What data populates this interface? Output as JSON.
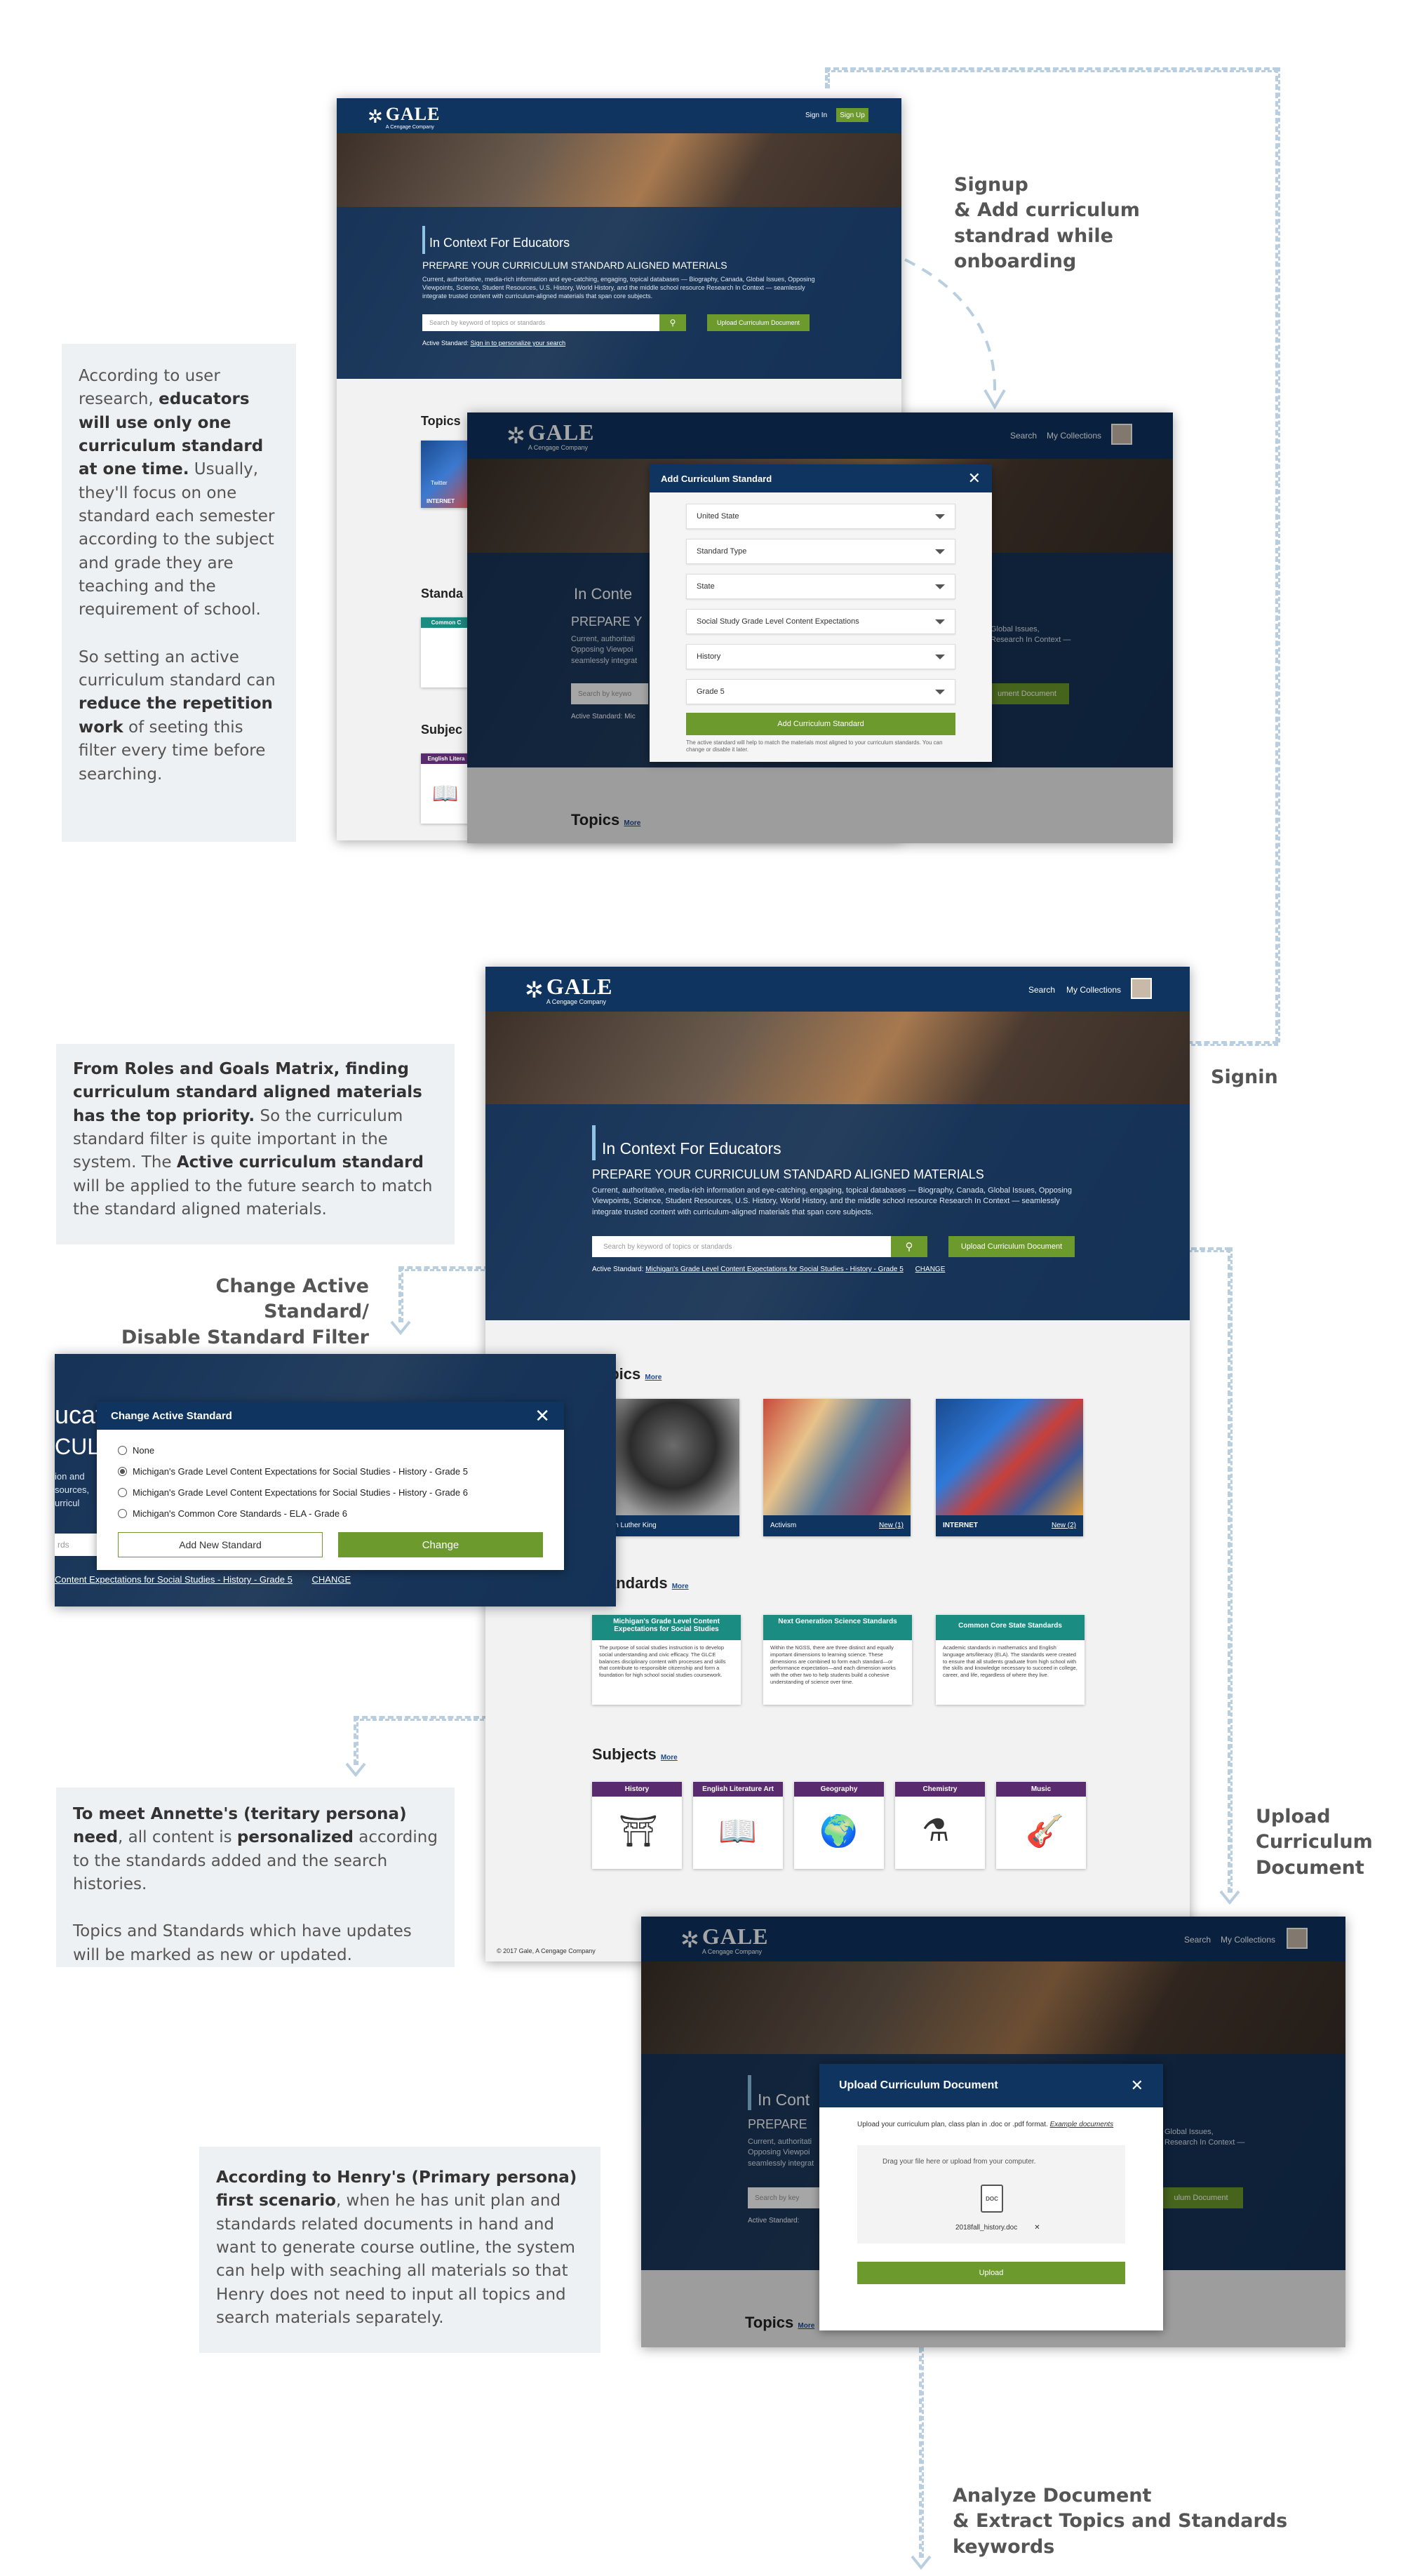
{
  "notes": {
    "educators_single_standard": {
      "p1_a": "According to user research, ",
      "p1_b": "educators will use only one curriculum standard at one time.",
      "p1_c": " Usually, they'll focus on one standard each semester according to the subject and grade they are teaching and the requirement of school.",
      "p2_a": "So setting an active curriculum standard can ",
      "p2_b": "reduce the repetition work",
      "p2_c": " of seeting this filter every time before searching."
    },
    "roles_goals": {
      "a": "From Roles and Goals Matrix, finding curriculum standard aligned materials has the top priority.",
      "b": " So the curriculum standard filter is quite important in the system. The ",
      "c": "Active curriculum standard",
      "d": " will be applied to the future search to match the standard aligned materials."
    },
    "annette": {
      "a": "To meet Annette's (teritary persona) need",
      "b": ", all content is ",
      "c": "personalized",
      "d": " according to the standards added and the search histories.",
      "p2": "Topics and Standards which have updates will be marked as new or updated."
    },
    "henry": {
      "a": "According to Henry's (Primary persona) first scenario",
      "b": ", when he has unit plan and standards related documents in hand and want to generate course outline, the system can help with seaching all materials so that Henry does not need to input all topics and search materials separately."
    }
  },
  "annotations": {
    "signup": [
      "Signup",
      "& Add curriculum",
      "standrad while",
      "onboarding"
    ],
    "signin": "Signin",
    "change_active": [
      "Change Active Standard/",
      "Disable Standard Filter"
    ],
    "upload": [
      "Upload",
      "Curriculum",
      "Document"
    ],
    "analyze": [
      "Analyze Document",
      "& Extract Topics and Standards",
      "keywords"
    ]
  },
  "brand": {
    "name": "GALE",
    "sub": "A Cengage Company"
  },
  "header": {
    "sign_in": "Sign In",
    "sign_up": "Sign Up",
    "search": "Search",
    "collections": "My Collections"
  },
  "hero": {
    "title": "In Context For Educators",
    "subtitle": "PREPARE YOUR CURRICULUM STANDARD ALIGNED MATERIALS",
    "desc": "Current, authoritative, media-rich information and eye-catching, engaging, topical databases — Biography, Canada, Global Issues, Opposing Viewpoints, Science, Student Resources, U.S. History, World History, and the middle school resource Research In Context — seamlessly integrate trusted content with curriculum-aligned materials that span core subjects.",
    "search_placeholder": "Search by keyword of topics or standards",
    "upload_btn": "Upload Curriculum Document",
    "active_label": "Active Standard:",
    "active_signin": "Sign in to personalize your search",
    "active_value": "Michigan's Grade Level Content Expectations for Social Studies - History - Grade 5",
    "change": "CHANGE"
  },
  "add_modal": {
    "title": "Add Curriculum Standard",
    "fields": [
      "United State",
      "Standard Type",
      "State",
      "Social Study Grade Level Content Expectations",
      "History",
      "Grade 5"
    ],
    "button": "Add Curriculum Standard",
    "note": "The active standard will help to match the materials most aligned to your curriculum standards. You can change or disable it later."
  },
  "change_modal": {
    "title": "Change Active Standard",
    "options": [
      "None",
      "Michigan's Grade Level Content Expectations for Social Studies - History - Grade 5",
      "Michigan's Grade Level Content Expectations for Social Studies - History - Grade 6",
      "Michigan's Common Core Standards - ELA - Grade 6"
    ],
    "selected_index": 1,
    "add_btn": "Add New Standard",
    "change_btn": "Change",
    "bg_title": "ucat",
    "bg_line": "CULU",
    "bg_text": [
      "ion and",
      "sources,",
      "urricul"
    ],
    "bg_search": "rds",
    "bg_active": "Content Expectations for Social Studies - History - Grade 5",
    "bg_change": "CHANGE"
  },
  "sections": {
    "topics": "Topics",
    "standards": "Standards",
    "subjects": "Subjects",
    "more": "More"
  },
  "topics": [
    {
      "name": "Martin Luther King",
      "badge": ""
    },
    {
      "name": "Activism",
      "badge": "New (1)"
    },
    {
      "name": "INTERNET",
      "badge": "New (2)"
    }
  ],
  "standards": [
    {
      "title": "Michigan's Grade Level Content Expectations for Social Studies",
      "body": "The purpose of social studies instruction is to develop social understanding and civic efficacy. The GLCE balances disciplinary content with processes and skills that contribute to responsible citizenship and form a foundation for high school social studies coursework."
    },
    {
      "title": "Next Generation Science Standards",
      "body": "Within the NGSS, there are three distinct and equally important dimensions to learning science. These dimensions are combined to form each standard—or performance expectation—and each dimension works with the other two to help students build a cohesive understanding of science over time."
    },
    {
      "title": "Common Core State Standards",
      "body": "Academic standards in mathematics and English language arts/literacy (ELA). The standards were created to ensure that all students graduate from high school with the skills and knowledge necessary to succeed in college, career, and life, regardless of where they live."
    }
  ],
  "subjects": [
    "History",
    "English Literature Art",
    "Geography",
    "Chemistry",
    "Music"
  ],
  "footer": "© 2017 Gale, A Cengage Company",
  "upload_modal": {
    "title": "Upload Curriculum Document",
    "desc": "Upload your curriculum plan, class plan in .doc or .pdf format. ",
    "example": "Example documents",
    "drop": "Drag your file here or upload from your computer.",
    "file": "2018fall_history.doc",
    "file_icon": "DOC",
    "button": "Upload"
  },
  "bg_fragments": {
    "topics_std": "Standa",
    "subj": "Subjec",
    "eng": "English Litera",
    "internet": "INTERNET",
    "common": "Common C",
    "in_context": "In Cont",
    "in_conte": "In Conte",
    "prepare": "PREPARE Y",
    "prepare2": "PRAPARE",
    "prepare3": "PREPARE",
    "current": "Current, authoritati",
    "opposing": "Opposing Viewpoi",
    "seam": "seamlessly integrat",
    "search_by": "Search by keywo",
    "search_by2": "Search by key",
    "active_m": "Active Standard: Mic",
    "active_m2": "Active Standard:",
    "ument": "ument Document",
    "ument2": "ulum Document",
    "gi": "Global Issues,",
    "gi2": "Research In Context —",
    "pics": "pics",
    "andards": "andards",
    "mlk_part": "tin Luther King",
    "twitter": "Twitter",
    "topics_m": "Topics",
    "topics_more": "More"
  },
  "colors": {
    "navy": "#0f3460",
    "green": "#6d9a2d",
    "teal": "#1b8c82",
    "purple": "#5a2a6e"
  }
}
